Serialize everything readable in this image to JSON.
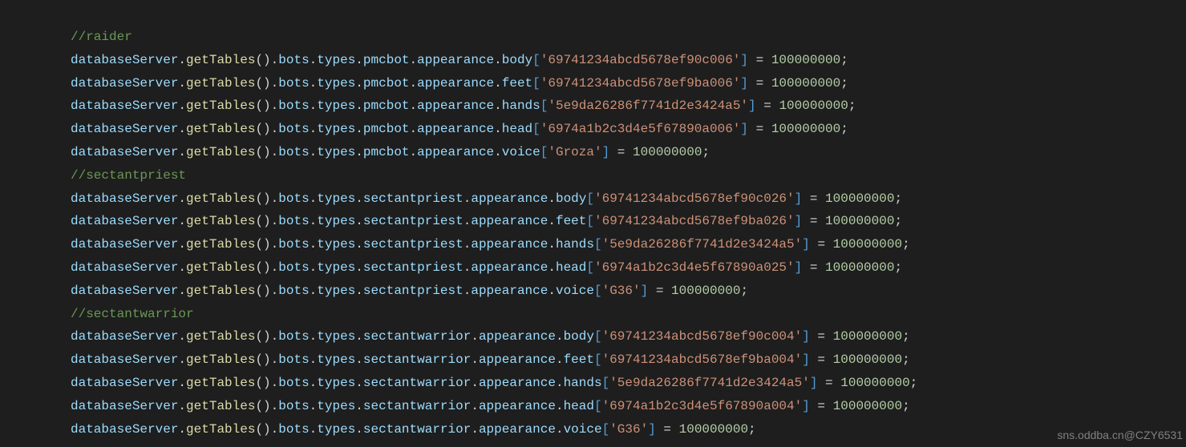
{
  "code": {
    "sections": [
      {
        "comment": "//raider",
        "lines": [
          {
            "var": "databaseServer",
            "method": "getTables",
            "path": "bots.types.pmcbot.appearance.body",
            "key": "'69741234abcd5678ef90c006'",
            "value": "100000000"
          },
          {
            "var": "databaseServer",
            "method": "getTables",
            "path": "bots.types.pmcbot.appearance.feet",
            "key": "'69741234abcd5678ef9ba006'",
            "value": "100000000"
          },
          {
            "var": "databaseServer",
            "method": "getTables",
            "path": "bots.types.pmcbot.appearance.hands",
            "key": "'5e9da26286f7741d2e3424a5'",
            "value": "100000000"
          },
          {
            "var": "databaseServer",
            "method": "getTables",
            "path": "bots.types.pmcbot.appearance.head",
            "key": "'6974a1b2c3d4e5f67890a006'",
            "value": "100000000"
          },
          {
            "var": "databaseServer",
            "method": "getTables",
            "path": "bots.types.pmcbot.appearance.voice",
            "key": "'Groza'",
            "value": "100000000"
          }
        ]
      },
      {
        "comment": "//sectantpriest",
        "lines": [
          {
            "var": "databaseServer",
            "method": "getTables",
            "path": "bots.types.sectantpriest.appearance.body",
            "key": "'69741234abcd5678ef90c026'",
            "value": "100000000"
          },
          {
            "var": "databaseServer",
            "method": "getTables",
            "path": "bots.types.sectantpriest.appearance.feet",
            "key": "'69741234abcd5678ef9ba026'",
            "value": "100000000"
          },
          {
            "var": "databaseServer",
            "method": "getTables",
            "path": "bots.types.sectantpriest.appearance.hands",
            "key": "'5e9da26286f7741d2e3424a5'",
            "value": "100000000"
          },
          {
            "var": "databaseServer",
            "method": "getTables",
            "path": "bots.types.sectantpriest.appearance.head",
            "key": "'6974a1b2c3d4e5f67890a025'",
            "value": "100000000"
          },
          {
            "var": "databaseServer",
            "method": "getTables",
            "path": "bots.types.sectantpriest.appearance.voice",
            "key": "'G36'",
            "value": "100000000"
          }
        ]
      },
      {
        "comment": "//sectantwarrior",
        "lines": [
          {
            "var": "databaseServer",
            "method": "getTables",
            "path": "bots.types.sectantwarrior.appearance.body",
            "key": "'69741234abcd5678ef90c004'",
            "value": "100000000"
          },
          {
            "var": "databaseServer",
            "method": "getTables",
            "path": "bots.types.sectantwarrior.appearance.feet",
            "key": "'69741234abcd5678ef9ba004'",
            "value": "100000000"
          },
          {
            "var": "databaseServer",
            "method": "getTables",
            "path": "bots.types.sectantwarrior.appearance.hands",
            "key": "'5e9da26286f7741d2e3424a5'",
            "value": "100000000"
          },
          {
            "var": "databaseServer",
            "method": "getTables",
            "path": "bots.types.sectantwarrior.appearance.head",
            "key": "'6974a1b2c3d4e5f67890a004'",
            "value": "100000000"
          },
          {
            "var": "databaseServer",
            "method": "getTables",
            "path": "bots.types.sectantwarrior.appearance.voice",
            "key": "'G36'",
            "value": "100000000"
          }
        ]
      }
    ]
  },
  "watermark": "sns.oddba.cn@CZY6531"
}
